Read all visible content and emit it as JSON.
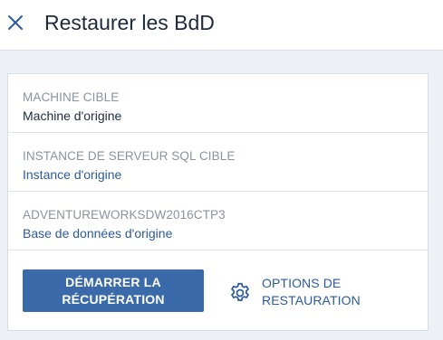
{
  "header": {
    "title": "Restaurer les BdD",
    "close_icon": "close-icon"
  },
  "target_machine": {
    "label": "MACHINE CIBLE",
    "value": "Machine d'origine"
  },
  "sql_instance": {
    "label": "INSTANCE DE SERVEUR SQL CIBLE",
    "value": "Instance d'origine"
  },
  "database": {
    "label": "ADVENTUREWORKSDW2016CTP3",
    "value": "Base de données d'origine"
  },
  "actions": {
    "start_recovery_label": "DÉMARRER LA RÉCUPÉRATION",
    "options_label": "OPTIONS DE RESTAURATION",
    "options_icon": "gear-icon"
  },
  "colors": {
    "accent": "#3b6aaa",
    "link": "#2d5a9a",
    "background": "#edf1f6"
  }
}
